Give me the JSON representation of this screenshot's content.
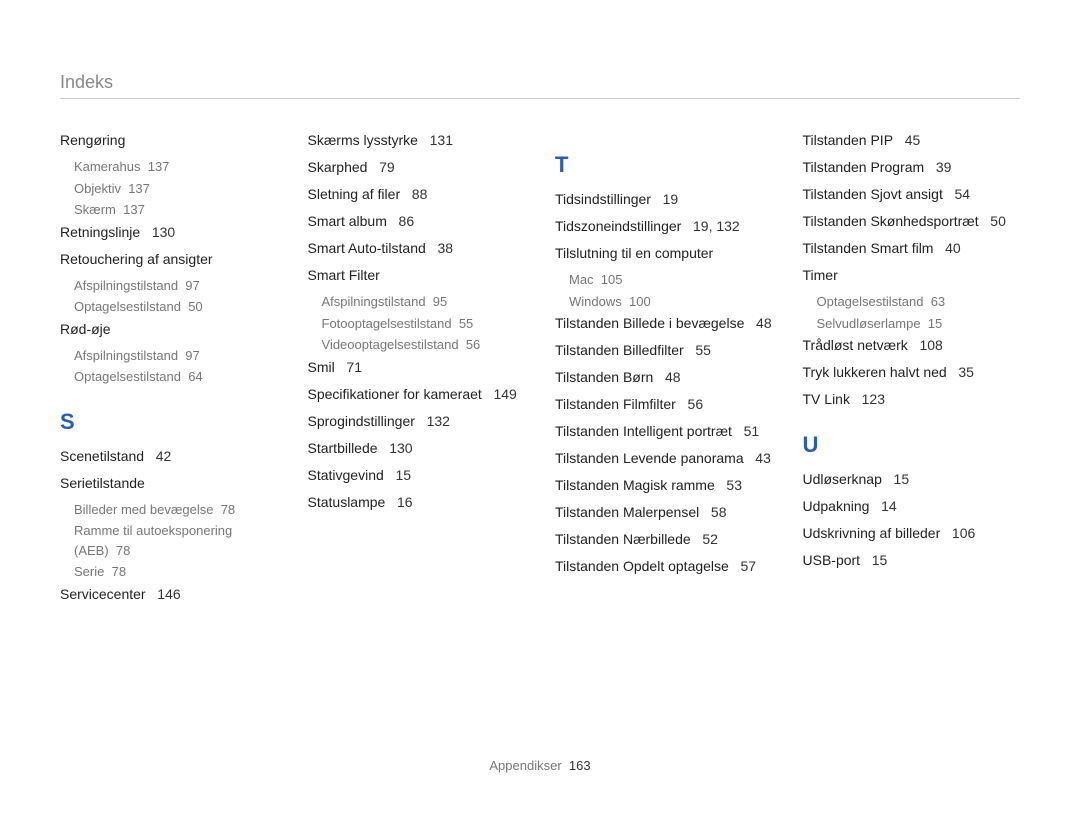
{
  "header": {
    "title": "Indeks"
  },
  "footer": {
    "label": "Appendikser",
    "page": "163"
  },
  "columns": [
    {
      "blocks": [
        {
          "type": "entry",
          "label": "Rengøring",
          "subs": [
            {
              "label": "Kamerahus",
              "page": "137"
            },
            {
              "label": "Objektiv",
              "page": "137"
            },
            {
              "label": "Skærm",
              "page": "137"
            }
          ]
        },
        {
          "type": "entry",
          "label": "Retningslinje",
          "page": "130"
        },
        {
          "type": "entry",
          "label": "Retouchering af ansigter",
          "subs": [
            {
              "label": "Afspilningstilstand",
              "page": "97"
            },
            {
              "label": "Optagelsestilstand",
              "page": "50"
            }
          ]
        },
        {
          "type": "entry",
          "label": "Rød-øje",
          "subs": [
            {
              "label": "Afspilningstilstand",
              "page": "97"
            },
            {
              "label": "Optagelsestilstand",
              "page": "64"
            }
          ]
        },
        {
          "type": "letter",
          "label": "S"
        },
        {
          "type": "entry",
          "label": "Scenetilstand",
          "page": "42"
        },
        {
          "type": "entry",
          "label": "Serietilstande",
          "subs": [
            {
              "label": "Billeder med bevægelse",
              "page": "78"
            },
            {
              "label": "Ramme til autoeksponering (AEB)",
              "page": "78"
            },
            {
              "label": "Serie",
              "page": "78"
            }
          ]
        },
        {
          "type": "entry",
          "label": "Servicecenter",
          "page": "146"
        }
      ]
    },
    {
      "blocks": [
        {
          "type": "entry",
          "label": "Skærms lysstyrke",
          "page": "131"
        },
        {
          "type": "entry",
          "label": "Skarphed",
          "page": "79"
        },
        {
          "type": "entry",
          "label": "Sletning af ﬁler",
          "page": "88"
        },
        {
          "type": "entry",
          "label": "Smart album",
          "page": "86"
        },
        {
          "type": "entry",
          "label": "Smart Auto-tilstand",
          "page": "38"
        },
        {
          "type": "entry",
          "label": "Smart Filter",
          "subs": [
            {
              "label": "Afspilningstilstand",
              "page": "95"
            },
            {
              "label": "Fotooptagelsestilstand",
              "page": "55"
            },
            {
              "label": "Videooptagelsestilstand",
              "page": "56"
            }
          ]
        },
        {
          "type": "entry",
          "label": "Smil",
          "page": "71"
        },
        {
          "type": "entry",
          "label": "Speciﬁkationer for kameraet",
          "page": "149"
        },
        {
          "type": "entry",
          "label": "Sprogindstillinger",
          "page": "132"
        },
        {
          "type": "entry",
          "label": "Startbillede",
          "page": "130"
        },
        {
          "type": "entry",
          "label": "Stativgevind",
          "page": "15"
        },
        {
          "type": "entry",
          "label": "Statuslampe",
          "page": "16"
        }
      ]
    },
    {
      "blocks": [
        {
          "type": "letter",
          "label": "T"
        },
        {
          "type": "entry",
          "label": "Tidsindstillinger",
          "page": "19"
        },
        {
          "type": "entry",
          "label": "Tidszoneindstillinger",
          "page": "19, 132"
        },
        {
          "type": "entry",
          "label": "Tilslutning til en computer",
          "subs": [
            {
              "label": "Mac",
              "page": "105"
            },
            {
              "label": "Windows",
              "page": "100"
            }
          ]
        },
        {
          "type": "entry",
          "label": "Tilstanden Billede i bevægelse",
          "page": "48"
        },
        {
          "type": "entry",
          "label": "Tilstanden Billedﬁlter",
          "page": "55"
        },
        {
          "type": "entry",
          "label": "Tilstanden Børn",
          "page": "48"
        },
        {
          "type": "entry",
          "label": "Tilstanden Filmﬁlter",
          "page": "56"
        },
        {
          "type": "entry",
          "label": "Tilstanden Intelligent portræt",
          "page": "51"
        },
        {
          "type": "entry",
          "label": "Tilstanden Levende panorama",
          "page": "43"
        },
        {
          "type": "entry",
          "label": "Tilstanden Magisk ramme",
          "page": "53"
        },
        {
          "type": "entry",
          "label": "Tilstanden Malerpensel",
          "page": "58"
        },
        {
          "type": "entry",
          "label": "Tilstanden Nærbillede",
          "page": "52"
        },
        {
          "type": "entry",
          "label": "Tilstanden Opdelt optagelse",
          "page": "57"
        }
      ]
    },
    {
      "blocks": [
        {
          "type": "entry",
          "label": "Tilstanden PIP",
          "page": "45"
        },
        {
          "type": "entry",
          "label": "Tilstanden Program",
          "page": "39"
        },
        {
          "type": "entry",
          "label": "Tilstanden Sjovt ansigt",
          "page": "54"
        },
        {
          "type": "entry",
          "label": "Tilstanden Skønhedsportræt",
          "page": "50"
        },
        {
          "type": "entry",
          "label": "Tilstanden Smart ﬁlm",
          "page": "40"
        },
        {
          "type": "entry",
          "label": "Timer",
          "subs": [
            {
              "label": "Optagelsestilstand",
              "page": "63"
            },
            {
              "label": "Selvudløserlampe",
              "page": "15"
            }
          ]
        },
        {
          "type": "entry",
          "label": "Trådløst netværk",
          "page": "108"
        },
        {
          "type": "entry",
          "label": "Tryk lukkeren halvt ned",
          "page": "35"
        },
        {
          "type": "entry",
          "label": "TV Link",
          "page": "123"
        },
        {
          "type": "letter",
          "label": "U"
        },
        {
          "type": "entry",
          "label": "Udløserknap",
          "page": "15"
        },
        {
          "type": "entry",
          "label": "Udpakning",
          "page": "14"
        },
        {
          "type": "entry",
          "label": "Udskrivning af billeder",
          "page": "106"
        },
        {
          "type": "entry",
          "label": "USB-port",
          "page": "15"
        }
      ]
    }
  ]
}
